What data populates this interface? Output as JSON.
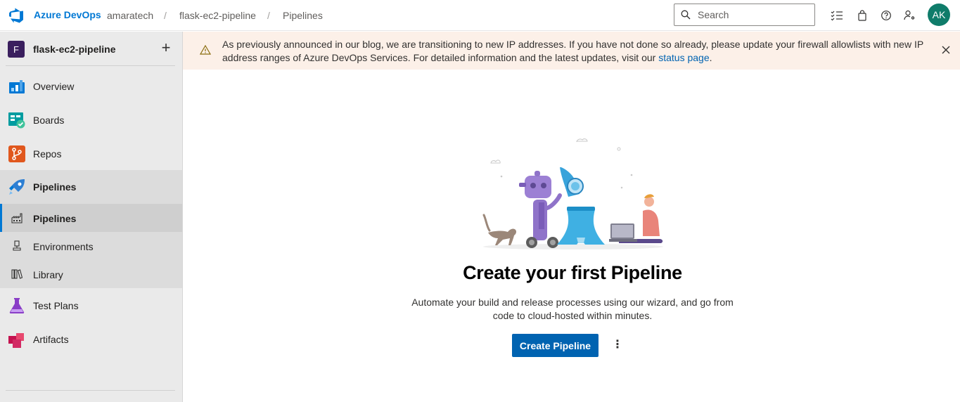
{
  "header": {
    "brand": "Azure DevOps",
    "breadcrumbs": [
      "amaratech",
      "flask-ec2-pipeline",
      "Pipelines"
    ],
    "search_placeholder": "Search",
    "avatar_initials": "AK",
    "icons": [
      "task-list-icon",
      "shopping-bag-icon",
      "help-icon",
      "user-settings-icon"
    ]
  },
  "sidebar": {
    "project_initial": "F",
    "project_name": "flask-ec2-pipeline",
    "add_label": "+",
    "items": [
      {
        "label": "Overview",
        "icon": "overview-icon"
      },
      {
        "label": "Boards",
        "icon": "boards-icon"
      },
      {
        "label": "Repos",
        "icon": "repos-icon"
      },
      {
        "label": "Pipelines",
        "icon": "pipelines-icon"
      },
      {
        "label": "Test Plans",
        "icon": "test-plans-icon"
      },
      {
        "label": "Artifacts",
        "icon": "artifacts-icon"
      }
    ],
    "sub_items": [
      {
        "label": "Pipelines",
        "icon": "pipelines-factory-icon",
        "selected": true
      },
      {
        "label": "Environments",
        "icon": "environments-icon"
      },
      {
        "label": "Library",
        "icon": "library-icon"
      }
    ]
  },
  "banner": {
    "message": "As previously announced in our blog, we are transitioning to new IP addresses. If you have not done so already, please update your firewall allowlists with new IP address ranges of Azure DevOps Services. For detailed information and the latest updates, visit our",
    "link": "status page",
    "end": "."
  },
  "main": {
    "title": "Create your first Pipeline",
    "description_line1": "Automate your build and release processes using our wizard, and go from",
    "description_line2": "code to cloud-hosted within minutes.",
    "primary_button": "Create Pipeline",
    "more_label": "⋮"
  },
  "colors": {
    "accent": "#0078d4",
    "primary_button": "#0063b1",
    "banner_bg": "#fcf0e8",
    "avatar_bg": "#0f7c6a",
    "sidebar_bg": "#eaeaea"
  }
}
